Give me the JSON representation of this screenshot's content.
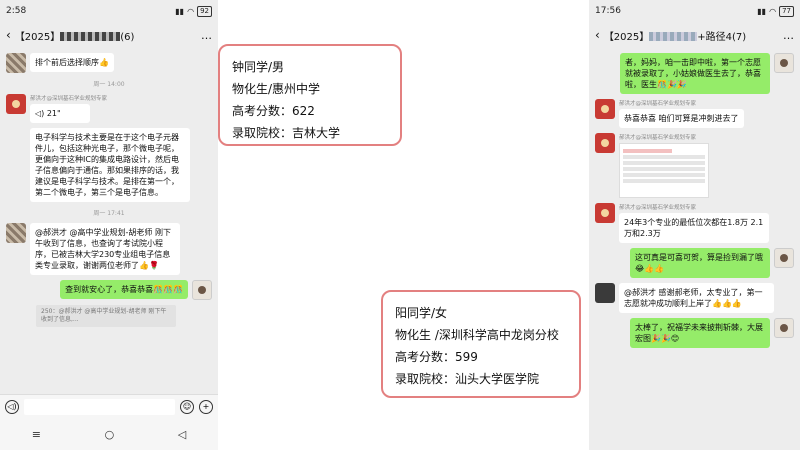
{
  "left_phone": {
    "status": {
      "time": "2:58",
      "battery": "92"
    },
    "header": {
      "back": "‹",
      "title_prefix": "【2025】",
      "title_suffix": "(6)",
      "action": "…"
    },
    "messages": [
      {
        "kind": "text",
        "side": "left",
        "text": "排个前后选择顺序👍"
      },
      {
        "kind": "time",
        "text": "周一 14:00"
      },
      {
        "kind": "voice",
        "side": "left",
        "sender": "郝洪才@深圳基石学业规划专家",
        "text": "21\""
      },
      {
        "kind": "text",
        "side": "left",
        "text": "电子科学与技术主要是在于这个电子元器件儿，包括这种光电子，那个微电子呢，更偏向于这种IC的集成电路设计，然后电子信息偏向于通信。那如果排序的话，我建议是电子科学与技术。是排在第一个，第二个微电子，第三个是电子信息。"
      },
      {
        "kind": "time",
        "text": "周一 17:41"
      },
      {
        "kind": "text",
        "side": "left",
        "text": "@郝洪才 @高中学业规划-胡老师 刚下午收到了信息，也查询了考试院小程序，已被吉林大学230专业组电子信息类专业录取，谢谢两位老师了👍🌹"
      },
      {
        "kind": "text",
        "side": "right",
        "text": "查到就安心了，恭喜恭喜🎊🎊🎊"
      },
      {
        "kind": "quote",
        "text": "250：@郝洪才 @高中学业规划-胡老师 刚下午收到了信息,..."
      }
    ],
    "nav": {
      "menu": "≡",
      "home": "○",
      "back": "◁"
    },
    "input": {
      "voice": "◁)",
      "emoji": "☺",
      "plus": "+"
    }
  },
  "right_phone": {
    "status": {
      "time": "17:56",
      "battery": "77"
    },
    "header": {
      "back": "‹",
      "title_prefix": "【2025】",
      "title_suffix": "+路径4(7)",
      "action": "…"
    },
    "messages": [
      {
        "kind": "text",
        "side": "right",
        "text": "者，妈妈，咱一击即中啦，第一个志愿就被录取了，小姑娘做医生去了，恭喜啦，医生🎊🎉🎉"
      },
      {
        "kind": "text",
        "side": "left",
        "sender": "郝洪才@深圳基石学业规划专家",
        "text": "恭喜恭喜 咱们可算是冲刺进去了"
      },
      {
        "kind": "image",
        "side": "left",
        "sender": "郝洪才@深圳基石学业规划专家"
      },
      {
        "kind": "text",
        "side": "left",
        "sender": "郝洪才@深圳基石学业规划专家",
        "text": "24年3个专业的最低位次都在1.8万 2.1万和2.3万"
      },
      {
        "kind": "text",
        "side": "right",
        "text": "这可真是可喜可贺，算是捡到漏了哦😂👍👍"
      },
      {
        "kind": "text",
        "side": "left",
        "text": "@郝洪才 感谢郝老师，太专业了，第一志愿就冲成功顺利上岸了👍👍👍"
      },
      {
        "kind": "text",
        "side": "right",
        "text": "太棒了，祝福学未来披荆斩棘，大展宏图🎉🎉😊"
      }
    ]
  },
  "cards": [
    {
      "lines": [
        "钟同学/男",
        "物化生/惠州中学",
        "高考分数：622",
        "录取院校：吉林大学"
      ]
    },
    {
      "lines": [
        "阳同学/女",
        "物化生 /深圳科学高中龙岗分校",
        "高考分数：599",
        "录取院校：汕头大学医学院"
      ]
    }
  ],
  "colors": {
    "card_border": "#e38080",
    "bubble_green": "#95ec69",
    "chat_bg": "#ededed"
  }
}
